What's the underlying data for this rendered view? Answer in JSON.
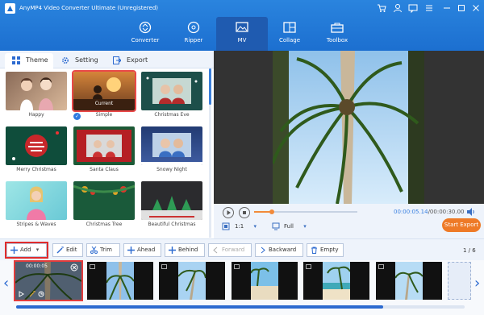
{
  "app": {
    "title": "AnyMP4 Video Converter Ultimate (Unregistered)"
  },
  "nav": {
    "tabs": [
      {
        "label": "Converter",
        "icon": "converter-icon"
      },
      {
        "label": "Ripper",
        "icon": "disc-icon"
      },
      {
        "label": "MV",
        "icon": "mv-image-icon",
        "active": true
      },
      {
        "label": "Collage",
        "icon": "collage-icon"
      },
      {
        "label": "Toolbox",
        "icon": "toolbox-icon"
      }
    ]
  },
  "side_tabs": [
    {
      "label": "Theme",
      "icon": "grid-icon",
      "active": true
    },
    {
      "label": "Setting",
      "icon": "gear-icon"
    },
    {
      "label": "Export",
      "icon": "export-icon"
    }
  ],
  "themes": [
    {
      "label": "Happy"
    },
    {
      "label": "Simple",
      "selected": true,
      "overlay": "Current"
    },
    {
      "label": "Christmas Eve"
    },
    {
      "label": "Merry Christmas"
    },
    {
      "label": "Santa Claus"
    },
    {
      "label": "Snowy Night"
    },
    {
      "label": "Stripes & Waves"
    },
    {
      "label": "Christmas Tree"
    },
    {
      "label": "Beautiful Christmas"
    }
  ],
  "player": {
    "current_time": "00:00:05.14",
    "total_time": "/00:00:30.00",
    "progress": 0.17,
    "ratio": "1:1",
    "mode": "Full",
    "export_label": "Start Export"
  },
  "toolbar": {
    "add": "Add",
    "edit": "Edit",
    "trim": "Trim",
    "ahead": "Ahead",
    "behind": "Behind",
    "forward": "Forward",
    "backward": "Backward",
    "empty": "Empty",
    "page": "1 / 6"
  },
  "timeline": {
    "first_clip_duration": "00:00:05",
    "clip_count": 6
  },
  "colors": {
    "header": "#1c6fd0",
    "accent": "#ee7a27",
    "highlight": "#e02c2c"
  }
}
